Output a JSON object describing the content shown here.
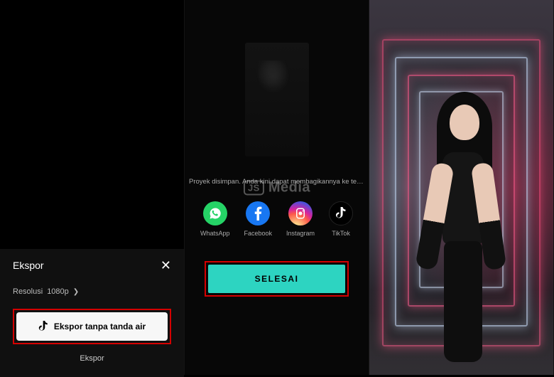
{
  "watermark": {
    "badge": "JS",
    "text": "Media"
  },
  "panel1": {
    "title": "Ekspor",
    "resolution_label": "Resolusi",
    "resolution_value": "1080p",
    "export_button": "Ekspor tanpa tanda air",
    "sub_label": "Ekspor"
  },
  "panel2": {
    "saved_text": "Proyek disimpan. Anda kini dapat membagikannya ke teman-teman An...",
    "share": {
      "whatsapp": "WhatsApp",
      "facebook": "Facebook",
      "instagram": "Instagram",
      "tiktok": "TikTok"
    },
    "done_button": "SELESAI"
  }
}
